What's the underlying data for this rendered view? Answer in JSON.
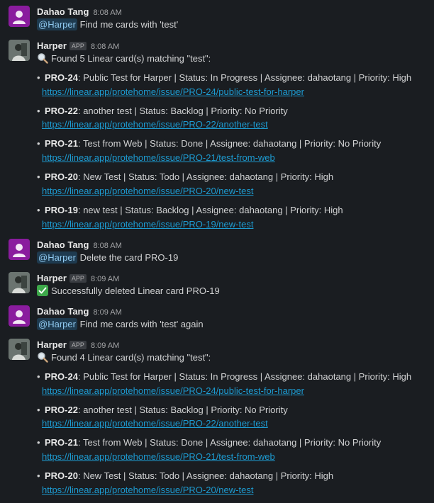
{
  "messages": [
    {
      "author": "Dahao Tang",
      "time": "8:08 AM",
      "mention": "@Harper",
      "text": "Find me cards with 'test'"
    },
    {
      "author": "Harper",
      "badge": "APP",
      "time": "8:08 AM",
      "header": "Found 5 Linear card(s) matching \"test\":",
      "cards": [
        {
          "id": "PRO-24",
          "desc": ": Public Test for Harper | Status: In Progress | Assignee: dahaotang | Priority: High",
          "url": "https://linear.app/protehome/issue/PRO-24/public-test-for-harper"
        },
        {
          "id": "PRO-22",
          "desc": ": another test | Status: Backlog | Priority: No Priority",
          "url": "https://linear.app/protehome/issue/PRO-22/another-test"
        },
        {
          "id": "PRO-21",
          "desc": ": Test from Web | Status: Done | Assignee: dahaotang | Priority: No Priority",
          "url": "https://linear.app/protehome/issue/PRO-21/test-from-web"
        },
        {
          "id": "PRO-20",
          "desc": ": New Test | Status: Todo | Assignee: dahaotang | Priority: High",
          "url": "https://linear.app/protehome/issue/PRO-20/new-test"
        },
        {
          "id": "PRO-19",
          "desc": ": new test | Status: Backlog | Assignee: dahaotang | Priority: High",
          "url": "https://linear.app/protehome/issue/PRO-19/new-test"
        }
      ]
    },
    {
      "author": "Dahao Tang",
      "time": "8:08 AM",
      "mention": "@Harper",
      "text": "Delete the card PRO-19"
    },
    {
      "author": "Harper",
      "badge": "APP",
      "time": "8:09 AM",
      "text": "Successfully deleted Linear card PRO-19"
    },
    {
      "author": "Dahao Tang",
      "time": "8:09 AM",
      "mention": "@Harper",
      "text": "Find me cards with 'test' again"
    },
    {
      "author": "Harper",
      "badge": "APP",
      "time": "8:09 AM",
      "header": "Found 4 Linear card(s) matching \"test\":",
      "cards": [
        {
          "id": "PRO-24",
          "desc": ": Public Test for Harper | Status: In Progress | Assignee: dahaotang | Priority: High",
          "url": "https://linear.app/protehome/issue/PRO-24/public-test-for-harper"
        },
        {
          "id": "PRO-22",
          "desc": ": another test | Status: Backlog | Priority: No Priority",
          "url": "https://linear.app/protehome/issue/PRO-22/another-test"
        },
        {
          "id": "PRO-21",
          "desc": ": Test from Web | Status: Done | Assignee: dahaotang | Priority: No Priority",
          "url": "https://linear.app/protehome/issue/PRO-21/test-from-web"
        },
        {
          "id": "PRO-20",
          "desc": ": New Test | Status: Todo | Assignee: dahaotang | Priority: High",
          "url": "https://linear.app/protehome/issue/PRO-20/new-test"
        }
      ]
    }
  ],
  "icons": {
    "search": "magnifying-glass-emoji",
    "check": "check-mark-emoji",
    "user_avatar": "default-user-avatar",
    "bot_avatar": "harper-bot-avatar"
  },
  "colors": {
    "link": "#1d9bd1",
    "mention_bg": "#1e3a4f",
    "user_avatar_bg": "#8a1c9e",
    "background": "#1a1d21"
  }
}
